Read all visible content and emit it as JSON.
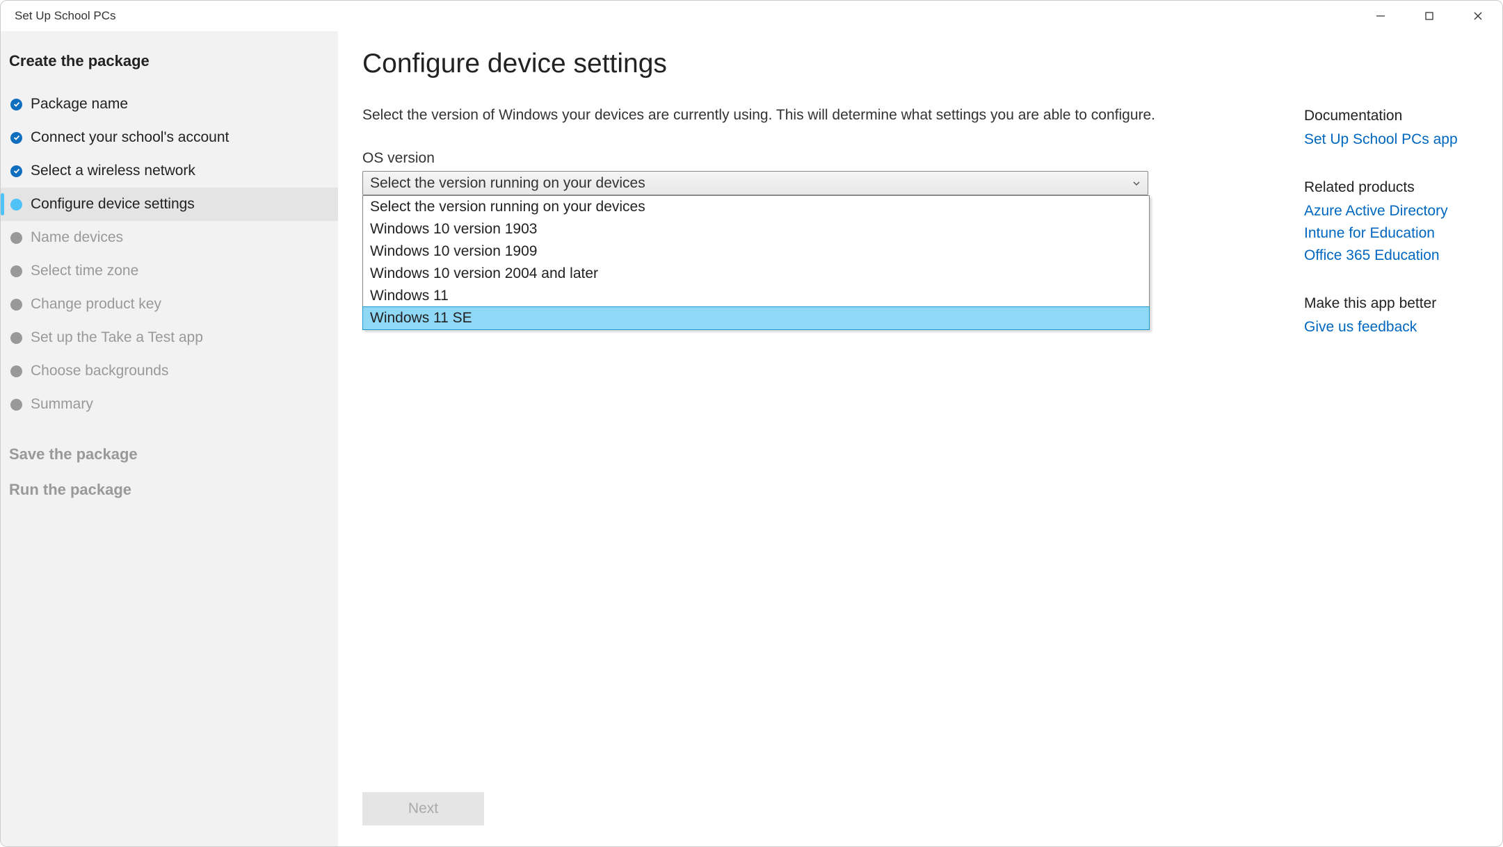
{
  "window": {
    "title": "Set Up School PCs"
  },
  "sidebar": {
    "section1_title": "Create the package",
    "section2_title": "Save the package",
    "section3_title": "Run the package",
    "items": [
      {
        "label": "Package name",
        "state": "done"
      },
      {
        "label": "Connect your school's account",
        "state": "done"
      },
      {
        "label": "Select a wireless network",
        "state": "done"
      },
      {
        "label": "Configure device settings",
        "state": "current"
      },
      {
        "label": "Name devices",
        "state": "future"
      },
      {
        "label": "Select time zone",
        "state": "future"
      },
      {
        "label": "Change product key",
        "state": "future"
      },
      {
        "label": "Set up the Take a Test app",
        "state": "future"
      },
      {
        "label": "Choose backgrounds",
        "state": "future"
      },
      {
        "label": "Summary",
        "state": "future"
      }
    ]
  },
  "main": {
    "title": "Configure device settings",
    "description": "Select the version of Windows your devices are currently using. This will determine what settings you are able to configure.",
    "os_label": "OS version",
    "select_placeholder": "Select the version running on your devices",
    "options": [
      "Select the version running on your devices",
      "Windows 10 version 1903",
      "Windows 10 version 1909",
      "Windows 10 version 2004 and later",
      "Windows 11",
      "Windows 11 SE"
    ],
    "next_label": "Next"
  },
  "right": {
    "doc_heading": "Documentation",
    "doc_link": "Set Up School PCs app",
    "related_heading": "Related products",
    "related_links": [
      "Azure Active Directory",
      "Intune for Education",
      "Office 365 Education"
    ],
    "better_heading": "Make this app better",
    "feedback_link": "Give us feedback"
  }
}
